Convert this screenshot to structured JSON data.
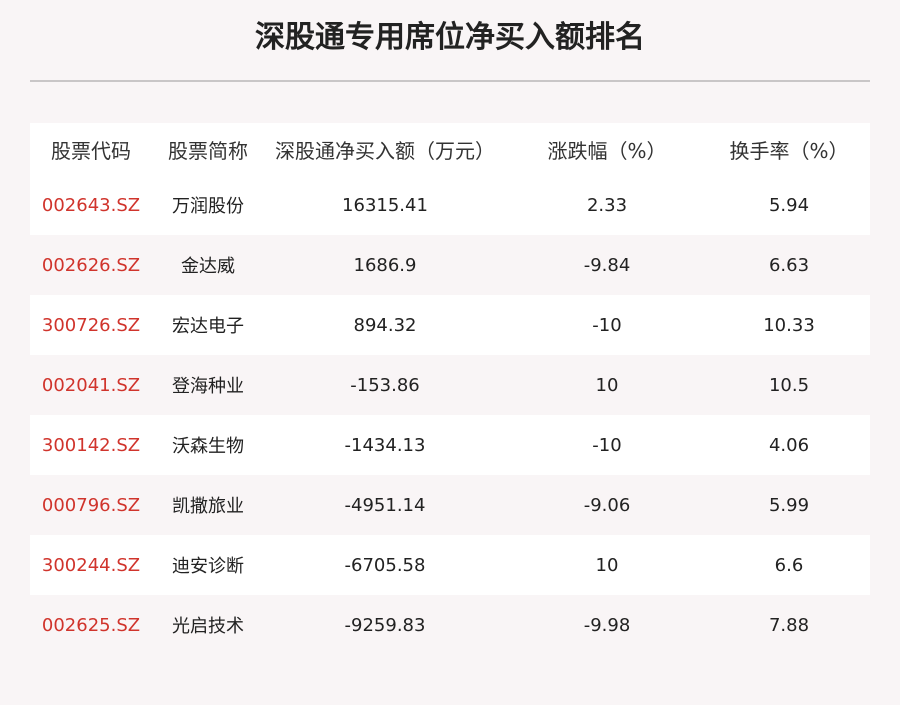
{
  "title": "深股通专用席位净买入额排名",
  "colors": {
    "code": "#d0342c",
    "background": "#f9f5f6",
    "row_alt": "#ffffff"
  },
  "table": {
    "headers": [
      "股票代码",
      "股票简称",
      "深股通净买入额（万元）",
      "涨跌幅（%）",
      "换手率（%）"
    ],
    "rows": [
      [
        "002643.SZ",
        "万润股份",
        "16315.41",
        "2.33",
        "5.94"
      ],
      [
        "002626.SZ",
        "金达威",
        "1686.9",
        "-9.84",
        "6.63"
      ],
      [
        "300726.SZ",
        "宏达电子",
        "894.32",
        "-10",
        "10.33"
      ],
      [
        "002041.SZ",
        "登海种业",
        "-153.86",
        "10",
        "10.5"
      ],
      [
        "300142.SZ",
        "沃森生物",
        "-1434.13",
        "-10",
        "4.06"
      ],
      [
        "000796.SZ",
        "凯撒旅业",
        "-4951.14",
        "-9.06",
        "5.99"
      ],
      [
        "300244.SZ",
        "迪安诊断",
        "-6705.58",
        "10",
        "6.6"
      ],
      [
        "002625.SZ",
        "光启技术",
        "-9259.83",
        "-9.98",
        "7.88"
      ]
    ]
  }
}
